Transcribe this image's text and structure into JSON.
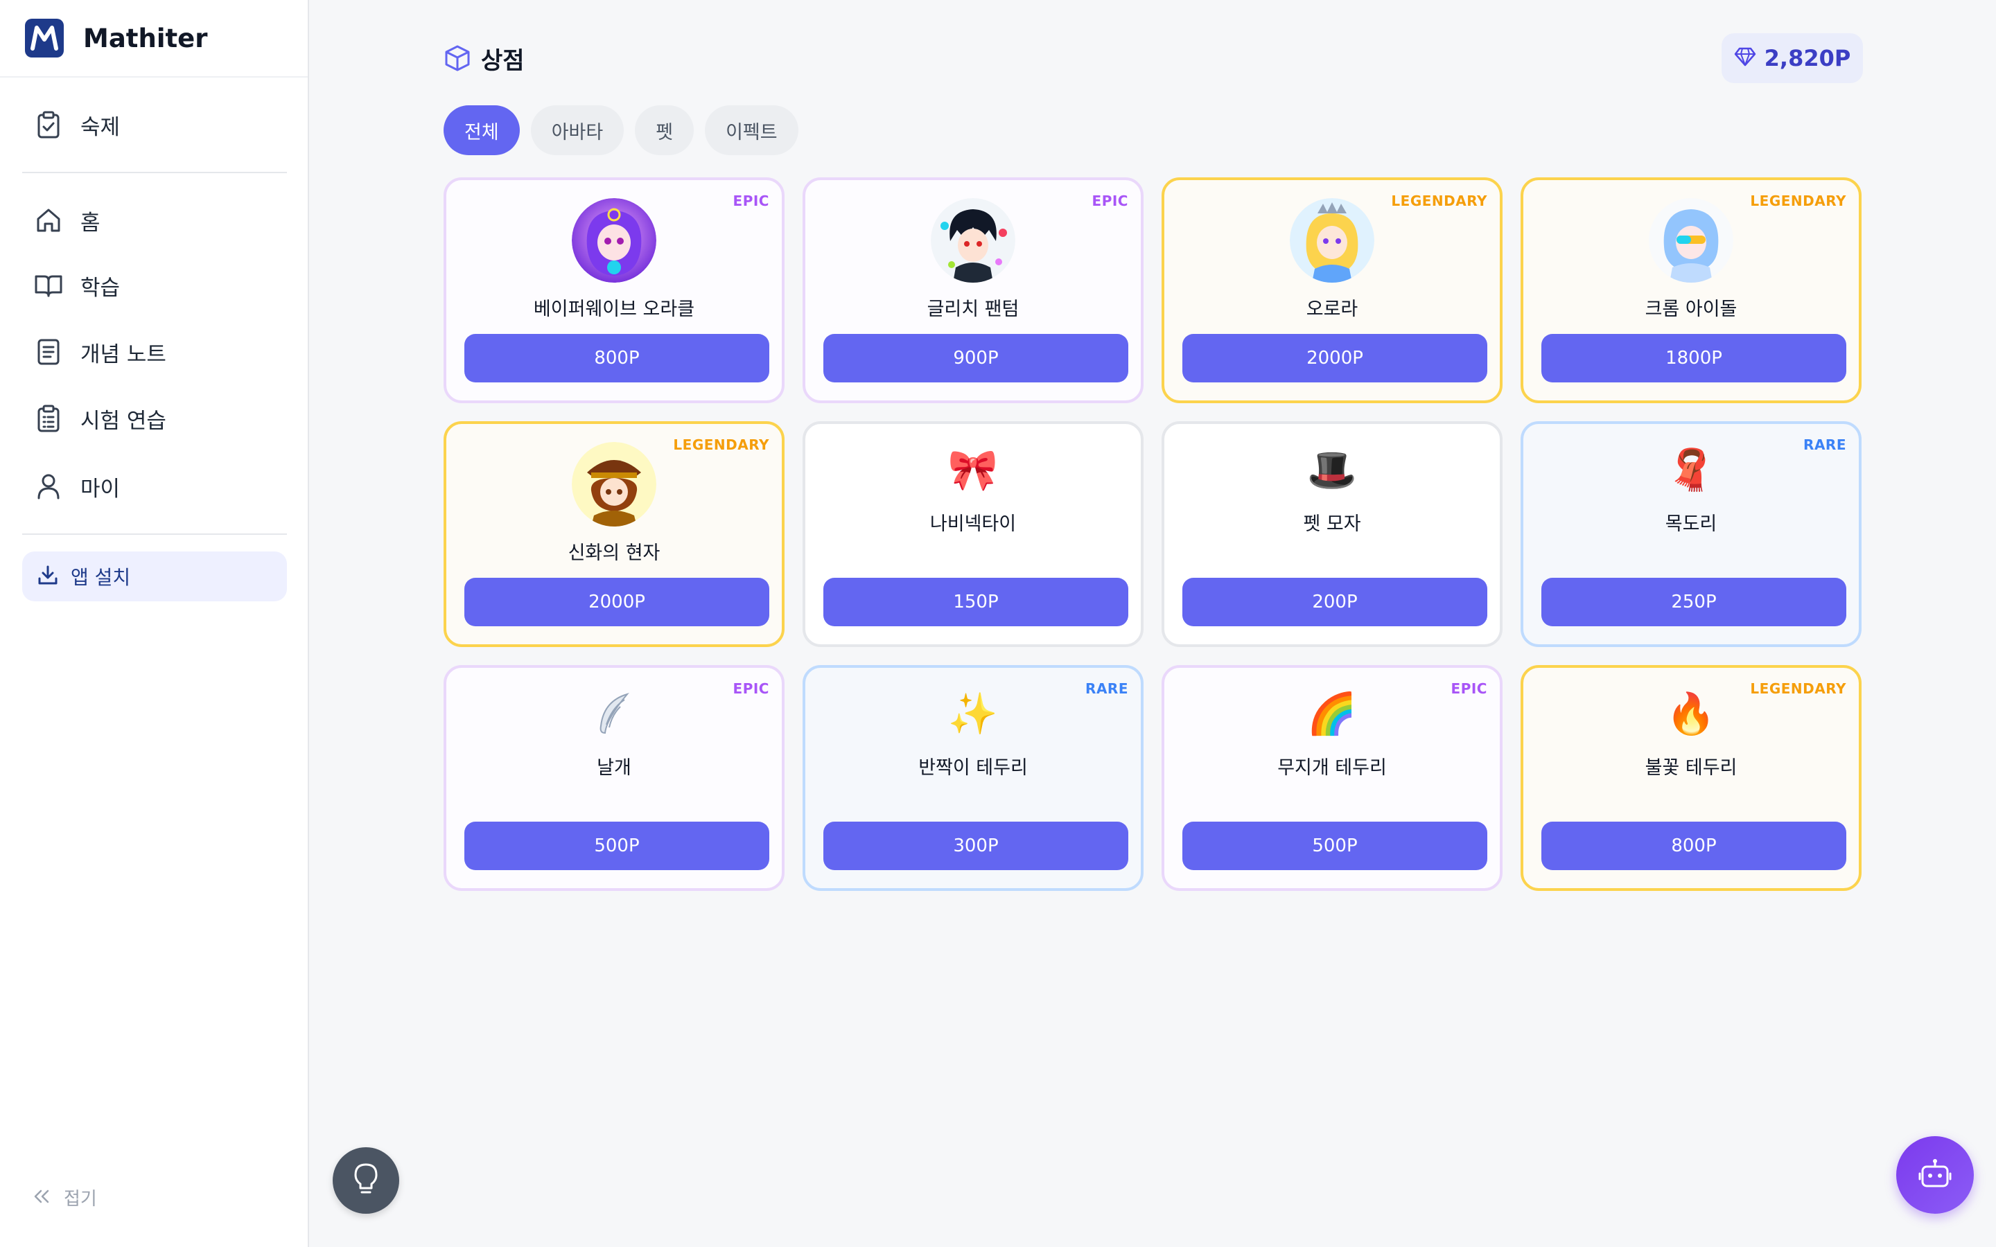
{
  "app": {
    "name": "Mathiter"
  },
  "sidebar": {
    "items": [
      {
        "label": "숙제",
        "icon": "clipboard-check-icon"
      },
      {
        "label": "홈",
        "icon": "home-icon"
      },
      {
        "label": "학습",
        "icon": "book-open-icon"
      },
      {
        "label": "개념 노트",
        "icon": "notes-icon"
      },
      {
        "label": "시험 연습",
        "icon": "clipboard-list-icon"
      },
      {
        "label": "마이",
        "icon": "user-icon"
      }
    ],
    "install_label": "앱 설치",
    "collapse_label": "접기"
  },
  "header": {
    "title": "상점",
    "points": "2,820P"
  },
  "tabs": [
    {
      "label": "전체",
      "active": true
    },
    {
      "label": "아바타",
      "active": false
    },
    {
      "label": "펫",
      "active": false
    },
    {
      "label": "이펙트",
      "active": false
    }
  ],
  "items": [
    {
      "name": "베이퍼웨이브 오라클",
      "price": "800P",
      "rarity": "EPIC",
      "kind": "avatar",
      "art": "avatar-oracle"
    },
    {
      "name": "글리치 팬텀",
      "price": "900P",
      "rarity": "EPIC",
      "kind": "avatar",
      "art": "avatar-phantom"
    },
    {
      "name": "오로라",
      "price": "2000P",
      "rarity": "LEGENDARY",
      "kind": "avatar",
      "art": "avatar-aurora"
    },
    {
      "name": "크롬 아이돌",
      "price": "1800P",
      "rarity": "LEGENDARY",
      "kind": "avatar",
      "art": "avatar-chrome"
    },
    {
      "name": "신화의 현자",
      "price": "2000P",
      "rarity": "LEGENDARY",
      "kind": "avatar",
      "art": "avatar-sage"
    },
    {
      "name": "나비넥타이",
      "price": "150P",
      "rarity": "",
      "kind": "emoji",
      "emoji": "🎀"
    },
    {
      "name": "펫 모자",
      "price": "200P",
      "rarity": "",
      "kind": "emoji",
      "emoji": "🎩"
    },
    {
      "name": "목도리",
      "price": "250P",
      "rarity": "RARE",
      "kind": "emoji",
      "emoji": "🧣"
    },
    {
      "name": "날개",
      "price": "500P",
      "rarity": "EPIC",
      "kind": "emoji",
      "emoji": "🪽"
    },
    {
      "name": "반짝이 테두리",
      "price": "300P",
      "rarity": "RARE",
      "kind": "emoji",
      "emoji": "✨"
    },
    {
      "name": "무지개 테두리",
      "price": "500P",
      "rarity": "EPIC",
      "kind": "emoji",
      "emoji": "🌈"
    },
    {
      "name": "불꽃 테두리",
      "price": "800P",
      "rarity": "LEGENDARY",
      "kind": "emoji",
      "emoji": "🔥"
    }
  ],
  "colors": {
    "accent": "#6366f1",
    "epic": "#a855f7",
    "legendary": "#f59e0b",
    "rare": "#3b82f6"
  }
}
